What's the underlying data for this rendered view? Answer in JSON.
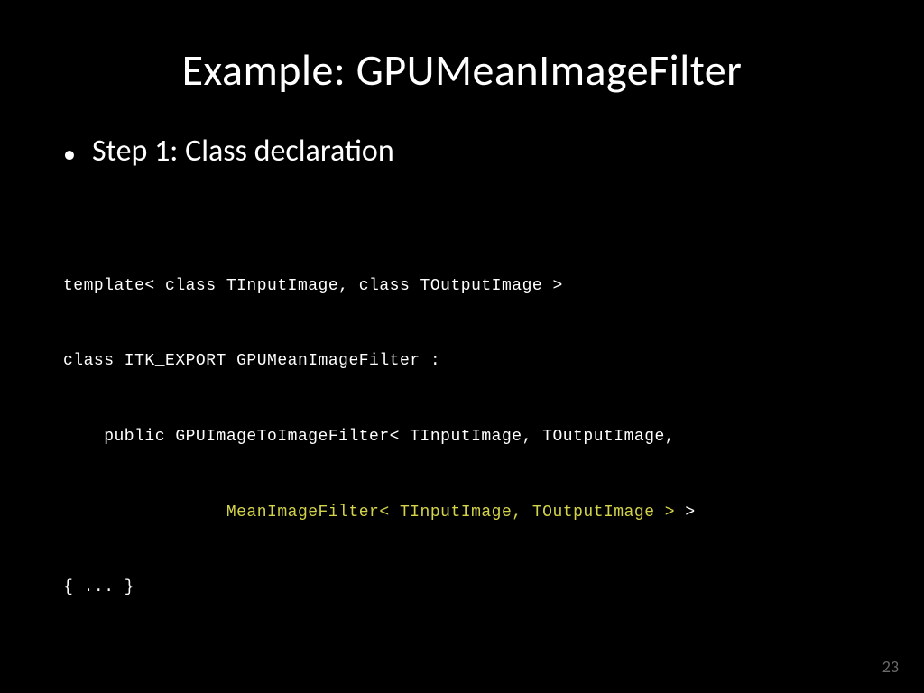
{
  "slide": {
    "title": "Example: GPUMeanImageFilter",
    "bullet": "Step 1: Class declaration",
    "code": {
      "line1": "template< class TInputImage, class TOutputImage >",
      "line2": "class ITK_EXPORT GPUMeanImageFilter :",
      "line3_prefix": "    public GPUImageToImageFilter< TInputImage, TOutputImage,",
      "line4_indent": "                ",
      "line4_highlight": "MeanImageFilter< TInputImage, TOutputImage >",
      "line4_suffix": " >",
      "line5": "{ ... }"
    },
    "page_number": "23"
  }
}
